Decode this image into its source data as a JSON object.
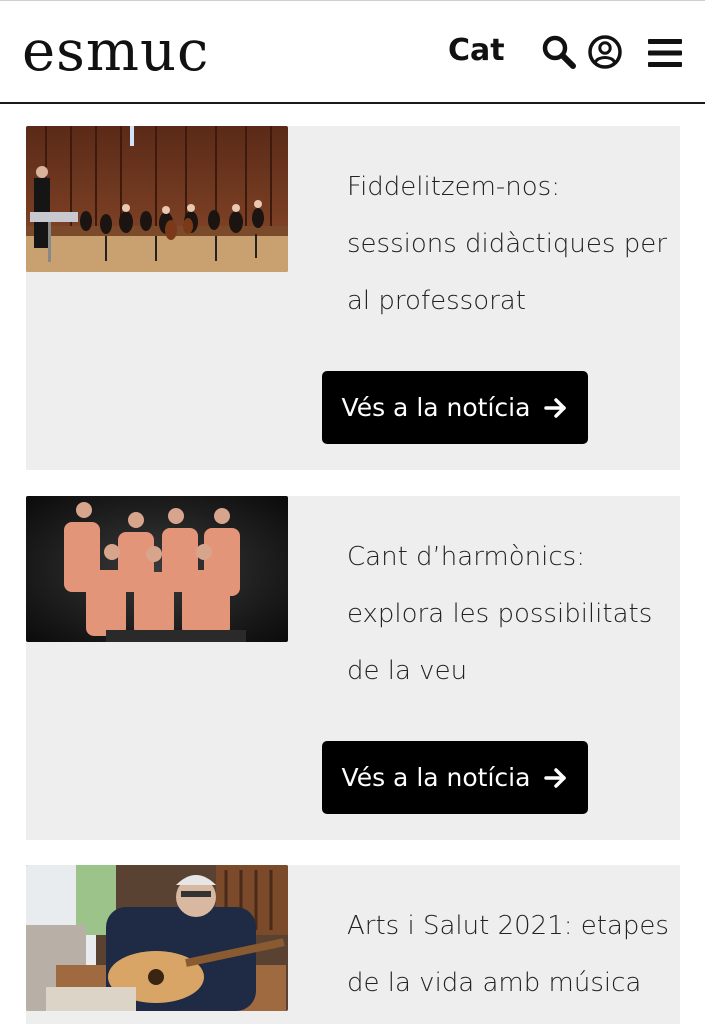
{
  "header": {
    "logo": "esmuc",
    "language": "Cat",
    "icons": [
      "search-icon",
      "user-icon",
      "menu-icon"
    ]
  },
  "news": [
    {
      "title_lines": [
        "Fiddelitzem-nos:",
        "sessions didàctiques per",
        "al professorat"
      ],
      "button_label": "Vés a la notícia",
      "image": "orchestra-concert-photo"
    },
    {
      "title_lines": [
        "Cant d’harmònics:",
        "explora les possibilitats",
        "de la veu"
      ],
      "button_label": "Vés a la notícia",
      "image": "vocal-ensemble-photo"
    },
    {
      "title_lines": [
        "Arts i Salut 2021: etapes",
        "de la vida amb música"
      ],
      "image": "guitarist-photo"
    }
  ],
  "colors": {
    "card_background": "#eeeeee",
    "button_background": "#000000",
    "button_text": "#ffffff"
  }
}
